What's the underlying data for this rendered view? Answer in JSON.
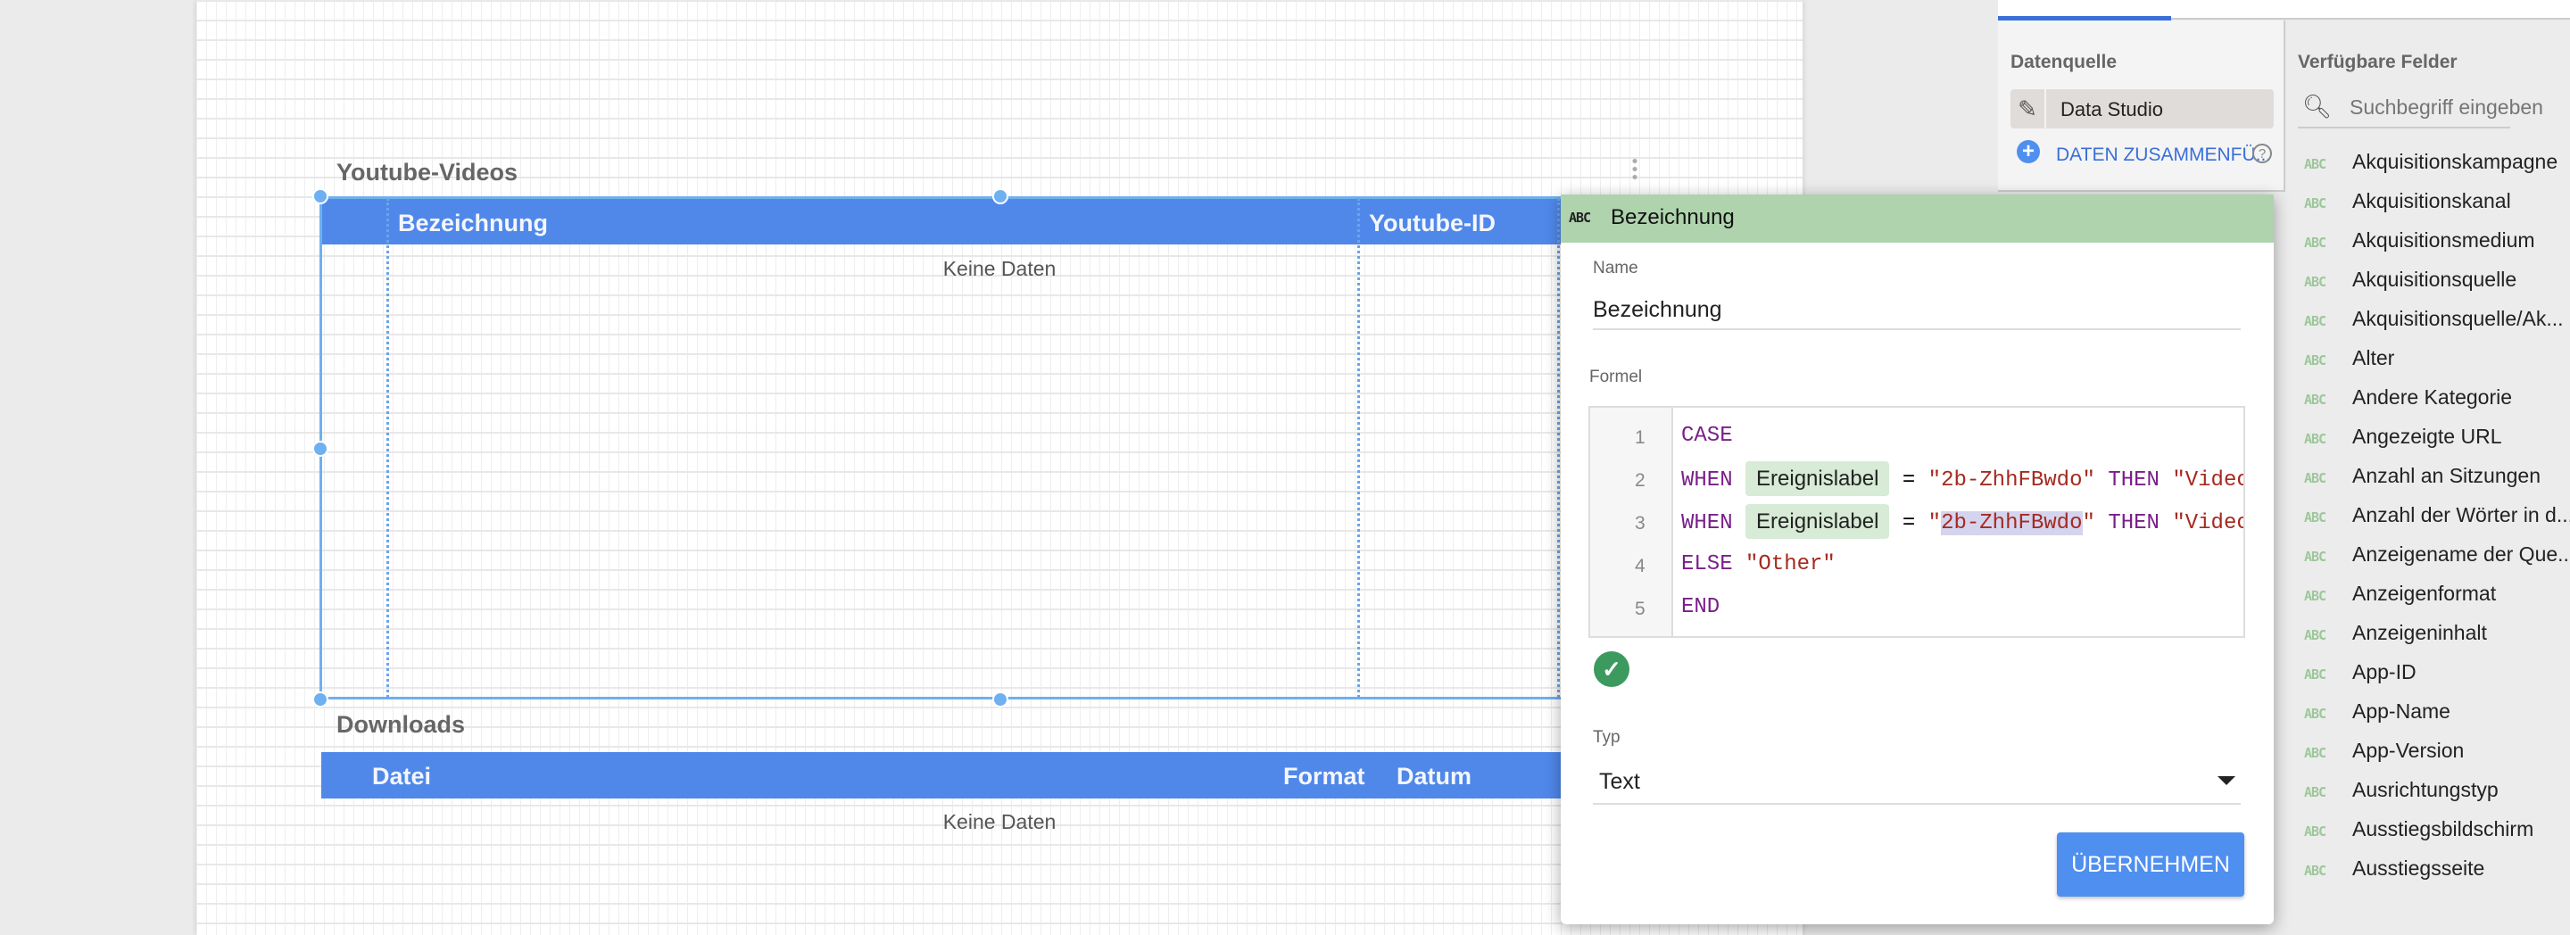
{
  "canvas": {
    "youtube_table": {
      "title": "Youtube-Videos",
      "columns": [
        "Bezeichnung",
        "Youtube-ID"
      ],
      "empty_text": "Keine Daten"
    },
    "downloads_table": {
      "title": "Downloads",
      "columns": [
        "Datei",
        "Format",
        "Datum"
      ],
      "empty_text": "Keine Daten"
    }
  },
  "dialog": {
    "type_badge": "ABC",
    "title": "Bezeichnung",
    "name_label": "Name",
    "name_value": "Bezeichnung",
    "formula_label": "Formel",
    "formula_lines": [
      {
        "num": "1",
        "kw1": "CASE"
      },
      {
        "num": "2",
        "kw1": "WHEN",
        "field": "Ereignislabel",
        "op": "=",
        "q1": "\"",
        "val": "2b-ZhhFBwdo",
        "q2": "\"",
        "kw2": "THEN",
        "result": "\"Video"
      },
      {
        "num": "3",
        "kw1": "WHEN",
        "field": "Ereignislabel",
        "op": "=",
        "q1": "\"",
        "val": "2b-ZhhFBwdo",
        "q2": "\"",
        "kw2": "THEN",
        "result": "\"Video"
      },
      {
        "num": "4",
        "kw1": "ELSE",
        "result": "\"Other\""
      },
      {
        "num": "5",
        "kw1": "END"
      }
    ],
    "valid_icon": "check-circle-icon",
    "type_label": "Typ",
    "type_value": "Text",
    "apply_button": "ÜBERNEHMEN",
    "colors": {
      "header": "#aed3ad",
      "button": "#4f8ff0",
      "valid": "#3c9a5f"
    }
  },
  "datasource": {
    "label": "Datenquelle",
    "source_name": "Data Studio",
    "merge_link": "DATEN ZUSAMMENFÜ..."
  },
  "fields": {
    "label": "Verfügbare Felder",
    "search_placeholder": "Suchbegriff eingeben",
    "type_badge": "ABC",
    "items": [
      "Akquisitionskampagne",
      "Akquisitionskanal",
      "Akquisitionsmedium",
      "Akquisitionsquelle",
      "Akquisitionsquelle/Ak...",
      "Alter",
      "Andere Kategorie",
      "Angezeigte URL",
      "Anzahl an Sitzungen",
      "Anzahl der Wörter in d...",
      "Anzeigename der Que...",
      "Anzeigenformat",
      "Anzeigeninhalt",
      "App-ID",
      "App-Name",
      "App-Version",
      "Ausrichtungstyp",
      "Ausstiegsbildschirm",
      "Ausstiegsseite"
    ]
  }
}
